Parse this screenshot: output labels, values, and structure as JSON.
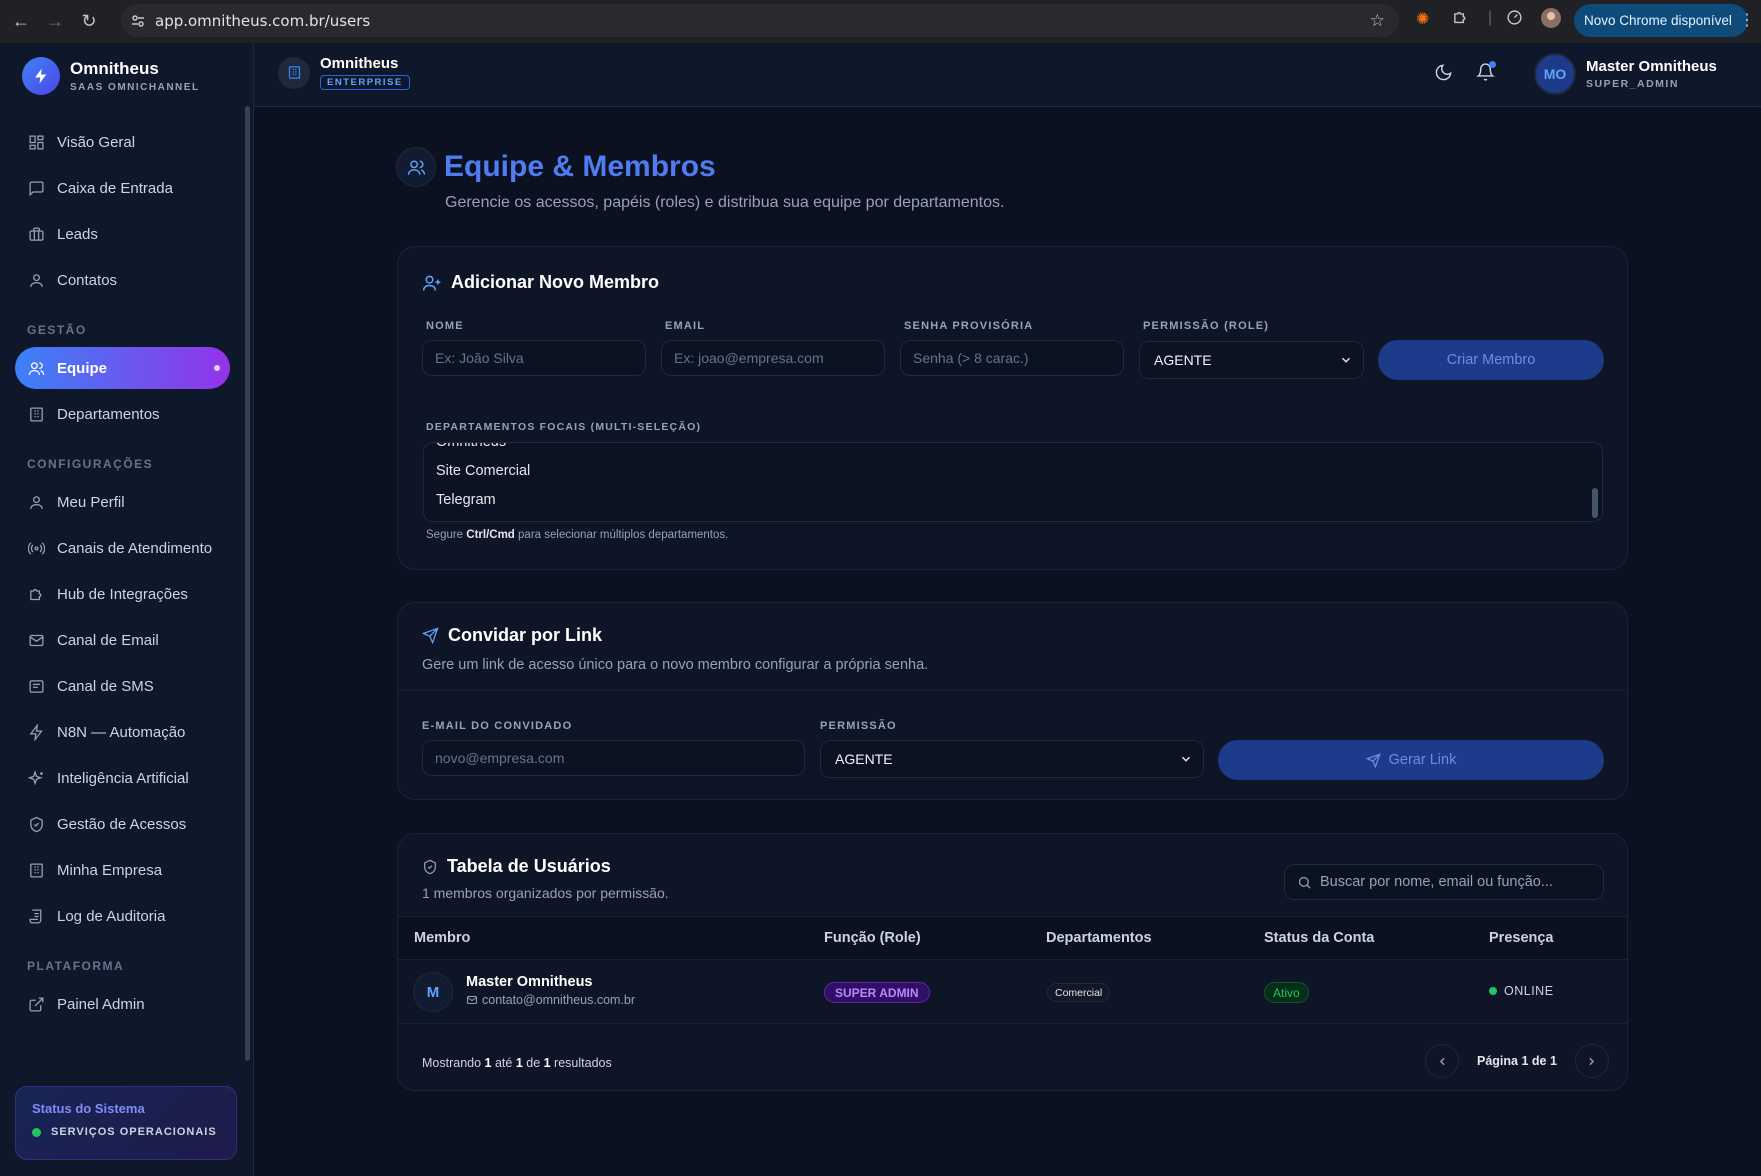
{
  "browser": {
    "url": "app.omnitheus.com.br/users",
    "chrome_badge": "Novo Chrome disponível"
  },
  "brand": {
    "name": "Omnitheus",
    "subtitle": "SAAS OMNICHANNEL"
  },
  "sidebar": {
    "main_items": [
      {
        "label": "Visão Geral",
        "icon": "dashboard-icon"
      },
      {
        "label": "Caixa de Entrada",
        "icon": "message-square-icon"
      },
      {
        "label": "Leads",
        "icon": "briefcase-icon"
      },
      {
        "label": "Contatos",
        "icon": "user-icon"
      }
    ],
    "section_gestao": "GESTÃO",
    "gestao_items": [
      {
        "label": "Equipe",
        "icon": "users-icon",
        "active": true
      },
      {
        "label": "Departamentos",
        "icon": "building-icon"
      }
    ],
    "section_config": "CONFIGURAÇÕES",
    "config_items": [
      {
        "label": "Meu Perfil",
        "icon": "user-icon"
      },
      {
        "label": "Canais de Atendimento",
        "icon": "radio-icon"
      },
      {
        "label": "Hub de Integrações",
        "icon": "puzzle-icon"
      },
      {
        "label": "Canal de Email",
        "icon": "mail-icon"
      },
      {
        "label": "Canal de SMS",
        "icon": "sms-icon"
      },
      {
        "label": "N8N — Automação",
        "icon": "zap-icon"
      },
      {
        "label": "Inteligência Artificial",
        "icon": "sparkles-icon"
      },
      {
        "label": "Gestão de Acessos",
        "icon": "shield-icon"
      },
      {
        "label": "Minha Empresa",
        "icon": "building-icon"
      },
      {
        "label": "Log de Auditoria",
        "icon": "scroll-icon"
      }
    ],
    "section_plataforma": "PLATAFORMA",
    "plataforma_items": [
      {
        "label": "Painel Admin",
        "icon": "external-link-icon"
      }
    ],
    "status": {
      "title": "Status do Sistema",
      "text": "SERVIÇOS OPERACIONAIS"
    }
  },
  "header": {
    "org_name": "Omnitheus",
    "org_plan": "ENTERPRISE",
    "user_initials": "MO",
    "user_name": "Master Omnitheus",
    "user_role": "SUPER_ADMIN"
  },
  "page": {
    "title": "Equipe & Membros",
    "subtitle": "Gerencie os acessos, papéis (roles) e distribua sua equipe por departamentos."
  },
  "add_member": {
    "title": "Adicionar Novo Membro",
    "name_label": "NOME",
    "name_placeholder": "Ex: João Silva",
    "email_label": "EMAIL",
    "email_placeholder": "Ex: joao@empresa.com",
    "password_label": "SENHA PROVISÓRIA",
    "password_placeholder": "Senha (> 8 carac.)",
    "role_label": "PERMISSÃO (ROLE)",
    "role_value": "AGENTE",
    "submit_label": "Criar Membro",
    "departments_label": "DEPARTAMENTOS FOCAIS (MULTI-SELEÇÃO)",
    "departments": [
      "Omnitheus",
      "Site Comercial",
      "Telegram"
    ],
    "hint_prefix": "Segure ",
    "hint_keys": "Ctrl/Cmd",
    "hint_suffix": " para selecionar múltiplos departamentos."
  },
  "invite": {
    "title": "Convidar por Link",
    "subtitle": "Gere um link de acesso único para o novo membro configurar a própria senha.",
    "email_label": "E-MAIL DO CONVIDADO",
    "email_placeholder": "novo@empresa.com",
    "role_label": "PERMISSÃO",
    "role_value": "AGENTE",
    "submit_label": "Gerar Link"
  },
  "users_table": {
    "title": "Tabela de Usuários",
    "subtitle": "1 membros organizados por permissão.",
    "search_placeholder": "Buscar por nome, email ou função...",
    "columns": [
      "Membro",
      "Função (Role)",
      "Departamentos",
      "Status da Conta",
      "Presença"
    ],
    "rows": [
      {
        "initial": "M",
        "name": "Master Omnitheus",
        "email": "contato@omnitheus.com.br",
        "role": "SUPER ADMIN",
        "department": "Comercial",
        "status": "Ativo",
        "presence": "ONLINE"
      }
    ],
    "footer": {
      "prefix": "Mostrando ",
      "from": "1",
      "mid1": " até ",
      "to": "1",
      "mid2": " de ",
      "total": "1",
      "suffix": " resultados"
    },
    "pagination": "Página 1 de 1"
  }
}
